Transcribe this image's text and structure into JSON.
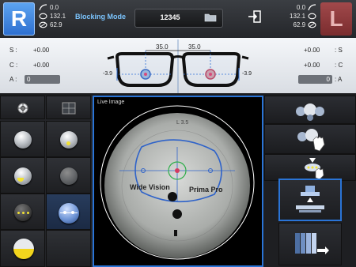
{
  "header": {
    "right_eye_label": "R",
    "left_eye_label": "L",
    "mode_label": "Blocking Mode",
    "job_number": "12345",
    "right_stats": {
      "curve": "0.0",
      "circumference": "132.1",
      "diameter": "62.9"
    },
    "left_stats": {
      "curve": "0.0",
      "circumference": "132.1",
      "diameter": "62.9"
    }
  },
  "lens": {
    "right": {
      "s_label": "S :",
      "s_value": "+0.00",
      "c_label": "C :",
      "c_value": "+0.00",
      "a_label": "A :",
      "a_value": "0",
      "offset": "-3.9",
      "pd": "35.0"
    },
    "left": {
      "s_label": ": S",
      "s_value": "+0.00",
      "c_label": ": C",
      "c_value": "+0.00",
      "a_label": ": A",
      "a_value": "0",
      "offset": "-3.9",
      "pd": "35.0"
    }
  },
  "live": {
    "title": "Live Image",
    "lens_text_left": "Wide Vision",
    "lens_text_right": "Prima Pro",
    "engraving": "L 3.5"
  },
  "colors": {
    "accent_blue": "#2a74d6",
    "right_blue": "#3e8cea",
    "left_red": "#8e3436",
    "mode_text": "#7cc5ff"
  },
  "icons": [
    "curve-icon",
    "circumference-icon",
    "diameter-icon",
    "folder-icon",
    "exit-icon",
    "target-icon",
    "grid-icon",
    "hand-icon",
    "block-icon",
    "arrow-icon"
  ]
}
